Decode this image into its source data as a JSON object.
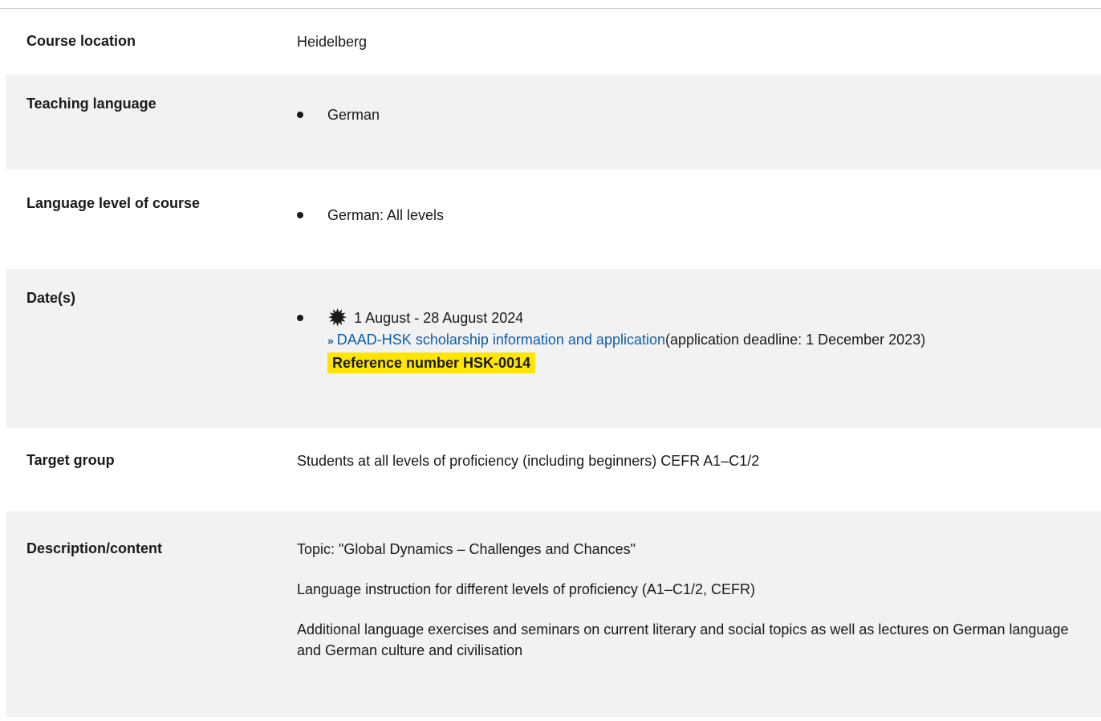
{
  "rows": {
    "location": {
      "label": "Course location",
      "value": "Heidelberg"
    },
    "teaching_language": {
      "label": "Teaching language",
      "items": [
        "German"
      ]
    },
    "language_level": {
      "label": "Language level of course",
      "items": [
        "German: All levels"
      ]
    },
    "dates": {
      "label": "Date(s)",
      "date_text": "1 August - 28 August 2024",
      "link_text": "DAAD-HSK scholarship information and application",
      "deadline_text": "(application deadline: 1 December 2023)",
      "reference": "Reference number HSK-0014",
      "icon": "sun-icon"
    },
    "target_group": {
      "label": "Target group",
      "value": "Students at all levels of proficiency (including beginners) CEFR A1–C1/2"
    },
    "description": {
      "label": "Description/content",
      "paragraphs": [
        "Topic: \"Global Dynamics – Challenges and Chances\"",
        "Language instruction for different levels of proficiency (A1–C1/2, CEFR)",
        "Additional language exercises and seminars on current literary and social topics as well as lectures on German language and German culture and civilisation"
      ]
    }
  },
  "colors": {
    "row_shade": "#f2f2f2",
    "link": "#0b5ea8",
    "highlight": "#ffe600"
  }
}
